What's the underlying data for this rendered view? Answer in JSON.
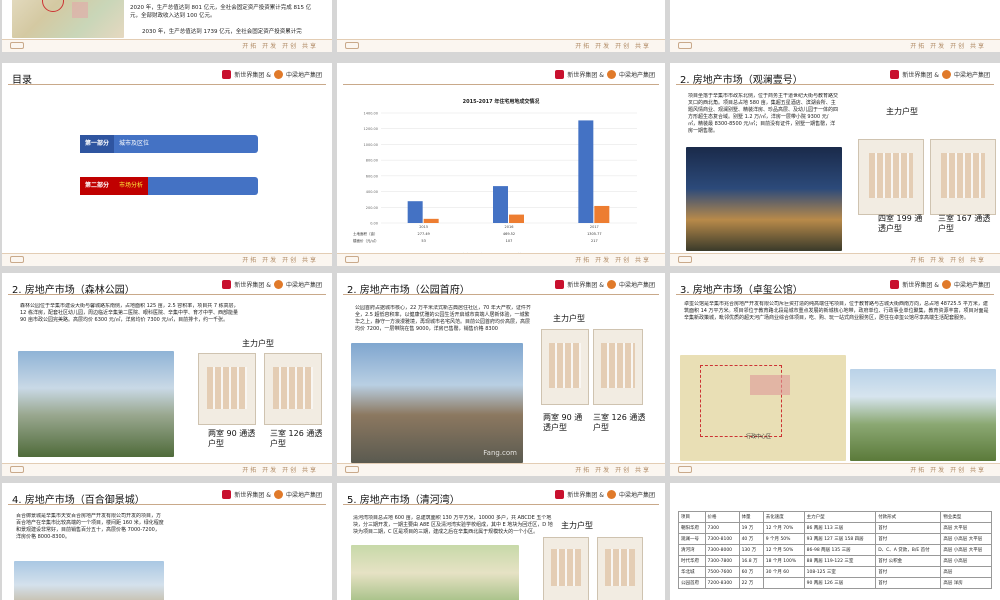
{
  "slides": {
    "s1": {
      "lines": [
        "2020 年，生产总值达到 801 亿元，全社会固定资产投资累计完成 815 亿元，全部财政收入达到 100 亿元。",
        "2030 年，生产总值达到 1739 亿元，全社会固定资产投资累计完"
      ]
    },
    "s4": {
      "title": "目录",
      "items": [
        {
          "key": "第一部分",
          "label": "城市及区位"
        },
        {
          "key": "第二部分",
          "label": "市场分析"
        }
      ]
    },
    "s5": {
      "chart_data": {
        "type": "bar",
        "title": "2015-2017 年住宅用地成交情况",
        "categories": [
          "2015",
          "2016",
          "2017"
        ],
        "series": [
          {
            "name": "土地面积（亩）",
            "values": [
              277.49,
              469.52,
              1305.77
            ]
          },
          {
            "name": "楼面价（元/㎡）",
            "values": [
              53,
              107,
              217
            ]
          }
        ],
        "yticks": [
          "1400.00",
          "1200.00",
          "1000.00",
          "800.00",
          "600.00",
          "400.00",
          "200.00",
          "0.00"
        ],
        "ylim": [
          0,
          1400
        ],
        "table": [
          [
            "土地面积（亩）",
            "277.49",
            "469.52",
            "1305.77"
          ],
          [
            "楼面价（元/㎡）",
            "53",
            "107",
            "217"
          ]
        ]
      }
    },
    "s6": {
      "title": "2. 房地产市场（观澜壹号）",
      "text": "项目坐落于辛集市市政东北侧，位于商务主干道世纪大街与教育路交叉口的西北角。项目总占地 580 亩，集超五星酒店、滨湖会所、主题风情商业、观澜别墅、精装洋房、珍品高层、及幼儿园于一体的四方形超生态复合域。别墅 1.2 万/㎡，洋房一层带小院 9300 元/㎡，精装最 8300-8500 元/㎡；目前没有证件，别墅一期售罄，洋房一期售罄。",
      "plan_title": "主力户型",
      "plans": [
        "四室 199 通透户型",
        "三室 167 通透户型"
      ]
    },
    "s7": {
      "title": "2. 房地产市场（森林公园）",
      "text": "森林公园位于辛集市建设大街与馨城路东南侧，占地面积 125 亩，2.5 容积率，项目共 7 栋高层，12 栋洋房，配套社区幼儿园，周边临近辛集第二医院、眼科医院、辛集中学、育才中学、西部能量 90 亩市政公园完美路。高层均价 6300 元/㎡，洋房均价 7300 元/㎡，目前排卡，约一千张。",
      "plan_title": "主力户型",
      "plans": [
        "两室 90 通透户型",
        "三室 126 通透户型"
      ]
    },
    "s8": {
      "title": "2. 房地产市场（公园首府）",
      "text": "公园首府占据城市核心，22 万平米法式新古典居住社区，70 年大产权，证件齐全，2.5 超低容积率，以健康优雅的公园生活开启城市高端人居新体验，一城繁华之上，静守一方浪漫雅境，再现城市名宅风范。目前公园首府均价高层，高层均价 7200，一层带院在售 9000，洋房已售罄，销售价格 8300",
      "plan_title": "主力户型",
      "plans": [
        "两室 90 通透户型",
        "三室 126 通透户型"
      ],
      "watermark": "Fang.com"
    },
    "s9": {
      "title": "3. 房地产市场（卓玺公馆）",
      "text": "卓玺公馆是辛集市兆合房地产开发有限公司斥巨资打造的纯高端住宅项目，位于教育路与古城大街西南方向，总占地 48725.5 平方米，建筑面积 14 万平方米。项目邻位于教育路北段是城市重点发展的新城核心地带，政府单位、行政事业单位聚集，教育资源丰富，项目对面是辛集新政策城，毗邻优质的超天河广场商业综合体项目，吃、购、玩一站式商业服务区，居住在卓玺公馆尽享高端生活配套服务。",
      "map_label": "行政中心区"
    },
    "s10": {
      "title": "4. 房地产市场（百合御景城）",
      "text": "百合御景城是辛集市天安百合房地产开发有限公司开发的项目，方百合地产在辛集市比较高端的一个项目，楼间距 160 米，绿化程度和景观建设非常好，目前销售百分五十，高层价格 7000-7200，洋房价格 8000-8300。"
    },
    "s11": {
      "title": "5. 房地产市场（清河湾）",
      "text": "清河湾项目总占地 600 亩，总建筑面积 130 万平方米，10000 多户，共 ABCDE 五个地块，分三期开发，一期主要由 A8E 区及清河湾实验学校组成，其中 E 地块为回迁区，D 地块为项目二期，C 区是项目的三期，建成之后在辛集西北属于规模较大的一个小区。",
      "plan_title": "主力户型"
    },
    "s12": {
      "table": [
        [
          "项目",
          "价格",
          "体量",
          "去化速度",
          "主力户型",
          "付款形式",
          "物业类型"
        ],
        [
          "朝阳华府",
          "7300",
          "19 万",
          "12 个月 70%",
          "86 两居 113 三居",
          "首付",
          "高层 大平层"
        ],
        [
          "观澜一号",
          "7300-8100",
          "40 万",
          "9 个月 50%",
          "93 两居 127 三居 158 四居",
          "首付",
          "高层 小高层 大平层"
        ],
        [
          "清河湾",
          "7300-8000",
          "130 万",
          "12 个月 50%",
          "86-98 两居 135 三居",
          "D、C、A 贷款，B/E 首付",
          "高层 小高层 大平层"
        ],
        [
          "时代华府",
          "7300-7800",
          "16.8 万",
          "18 个月 100%",
          "88 两居 119-122 三室",
          "首付 公积金",
          "高层 小高层"
        ],
        [
          "华北城",
          "7500-7600",
          "60 万",
          "30 个月 60",
          "108-125 三室",
          "首付",
          "高层"
        ],
        [
          "公园首府",
          "7200-8300",
          "22 万",
          "",
          "90 两居 126 三居",
          "首付",
          "高层 洋房"
        ]
      ]
    },
    "footer": {
      "signature": "开拓  开发  开创  共享"
    }
  }
}
